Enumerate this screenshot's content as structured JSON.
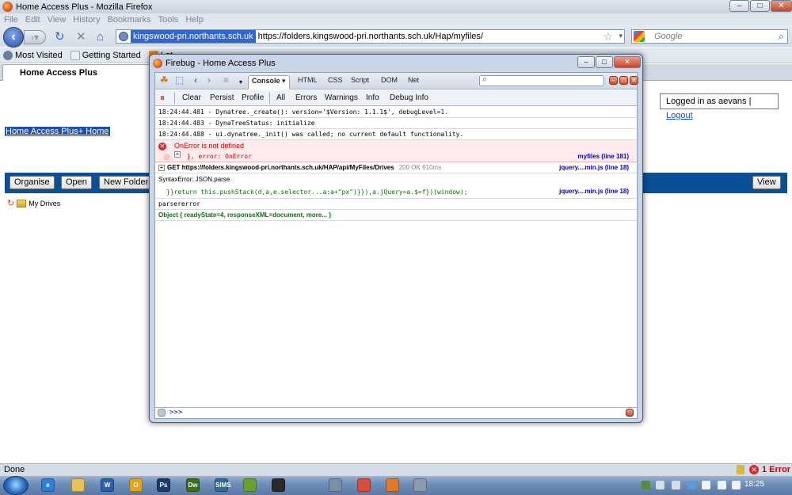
{
  "window": {
    "title": "Home Access Plus - Mozilla Firefox",
    "controls": {
      "minimize": "–",
      "maximize": "□",
      "close": "✕"
    }
  },
  "menu": [
    "File",
    "Edit",
    "View",
    "History",
    "Bookmarks",
    "Tools",
    "Help"
  ],
  "address": {
    "identity": "kingswood-pri.northants.sch.uk",
    "url": "https://folders.kingswood-pri.northants.sch.uk/Hap/myfiles/"
  },
  "search": {
    "placeholder": "Google"
  },
  "bookmarks": [
    {
      "label": "Most Visited",
      "icon": "gear-icon",
      "color": "#6a7d99"
    },
    {
      "label": "Getting Started",
      "icon": "page-icon",
      "color": "#e9eef4"
    },
    {
      "label": "Lat",
      "icon": "rss-icon",
      "color": "#f08a24"
    }
  ],
  "tab": {
    "label": "Home Access Plus"
  },
  "page": {
    "home_link": "Home Access Plus+ Home",
    "logged_in_prefix": "Logged in as aevans |",
    "logout": "Logout",
    "buttons": [
      "Organise",
      "Open",
      "New Folder"
    ],
    "view_button": "View",
    "drives_label": "My Drives"
  },
  "firebug": {
    "title": "Firebug - Home Access Plus",
    "tabs": [
      "Console ▾",
      "HTML",
      "CSS",
      "Script",
      "DOM",
      "Net"
    ],
    "subtabs": [
      "Clear",
      "Persist",
      "Profile",
      "All",
      "Errors",
      "Warnings",
      "Info",
      "Debug Info"
    ],
    "log": [
      {
        "time": "18:24:44.481",
        "text": " - Dynatree._create(): version='$Version: 1.1.1$', debugLevel=",
        "num": "1."
      },
      {
        "time": "18:24:44.483",
        "text": " - DynaTreeStatus: initialize",
        "num": ""
      },
      {
        "time": "18:24:44.488",
        "text": " - ui.dynatree._init() was called; no current default functionality.",
        "num": ""
      }
    ],
    "error": {
      "message": "OnError is not defined",
      "code": "}, error: OnError",
      "source": "myfiles (line 181)"
    },
    "get": {
      "url": "GET https://folders.kingswood-pri.northants.sch.uk/HAP/api/MyFiles/Drives",
      "status": "200 OK 610ms",
      "source": "jquery....min.js (line 18)"
    },
    "syntax": {
      "title": "SyntaxError: JSON.parse",
      "code": "}}return this.pushStack(d,a,e.selector...a:a+\"px\")}}),a.jQuery=a.$=f})(window);",
      "source": "jquery....min.js (line 18)"
    },
    "parsererror": "parsererror",
    "object": {
      "prefix": "Object {",
      "ready": "readyState=4,",
      "xml": "responseXML=document,",
      "more": "more...",
      "suffix": "}"
    },
    "prompt": ">>>"
  },
  "status": {
    "done": "Done",
    "errors": "1 Error"
  },
  "taskbar": {
    "apps": [
      {
        "name": "ie-icon",
        "color": "#2b7fd6",
        "label": "e"
      },
      {
        "name": "explorer-icon",
        "color": "#e6c35a",
        "label": ""
      },
      {
        "name": "word-icon",
        "color": "#2a5fb0",
        "label": "W"
      },
      {
        "name": "outlook-icon",
        "color": "#e0a41f",
        "label": "O"
      },
      {
        "name": "photoshop-icon",
        "color": "#1b3c6e",
        "label": "Ps"
      },
      {
        "name": "dreamweaver-icon",
        "color": "#3c6e1b",
        "label": "Dw"
      },
      {
        "name": "sims-icon",
        "color": "#2f6c99",
        "label": "SIMS"
      },
      {
        "name": "spotify-icon",
        "color": "#6aa12e",
        "label": ""
      },
      {
        "name": "blackberry-icon",
        "color": "#2a2a2a",
        "label": ""
      },
      {
        "name": "tool-icon",
        "color": "#7a8ea8",
        "label": ""
      },
      {
        "name": "chrome-icon",
        "color": "#d94b3b",
        "label": ""
      },
      {
        "name": "firefox-icon",
        "color": "#e07a27",
        "label": ""
      },
      {
        "name": "misc-icon",
        "color": "#8a9bb0",
        "label": ""
      }
    ],
    "clock": "18:25"
  }
}
